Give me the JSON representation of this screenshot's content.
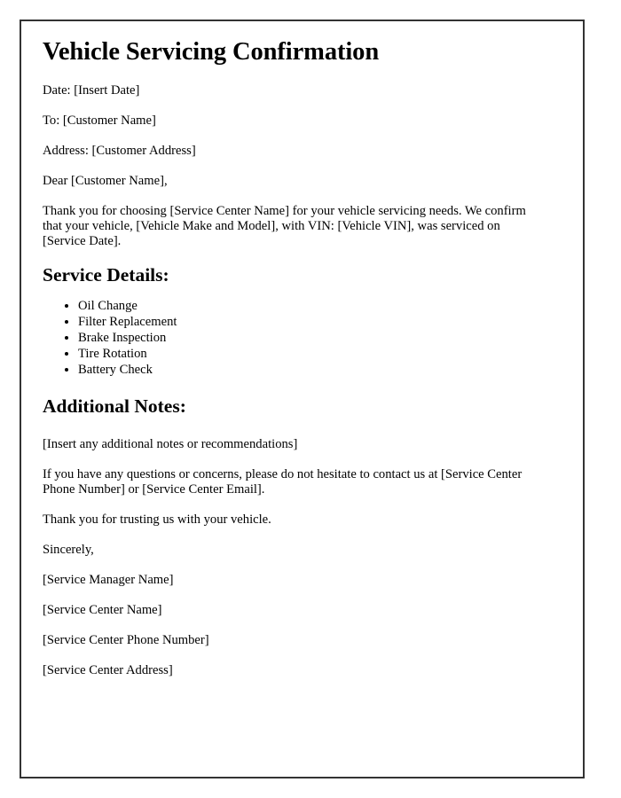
{
  "document": {
    "title": "Vehicle Servicing Confirmation",
    "date_line": "Date: [Insert Date]",
    "to_line": "To: [Customer Name]",
    "address_line": "Address: [Customer Address]",
    "salutation": "Dear [Customer Name],",
    "intro_paragraph": "Thank you for choosing [Service Center Name] for your vehicle servicing needs. We confirm that your vehicle, [Vehicle Make and Model], with VIN: [Vehicle VIN], was serviced on [Service Date].",
    "service_details": {
      "heading": "Service Details:",
      "items": [
        "Oil Change",
        "Filter Replacement",
        "Brake Inspection",
        "Tire Rotation",
        "Battery Check"
      ]
    },
    "additional_notes": {
      "heading": "Additional Notes:",
      "placeholder_paragraph": "[Insert any additional notes or recommendations]",
      "contact_paragraph": "If you have any questions or concerns, please do not hesitate to contact us at [Service Center Phone Number] or [Service Center Email].",
      "closing_thanks": "Thank you for trusting us with your vehicle."
    },
    "signature": {
      "sign_off": "Sincerely,",
      "manager_name": "[Service Manager Name]",
      "center_name": "[Service Center Name]",
      "center_phone": "[Service Center Phone Number]",
      "center_address": "[Service Center Address]"
    }
  },
  "style": {
    "page_background": "#ffffff",
    "border_color": "#333333",
    "text_color": "#000000"
  }
}
